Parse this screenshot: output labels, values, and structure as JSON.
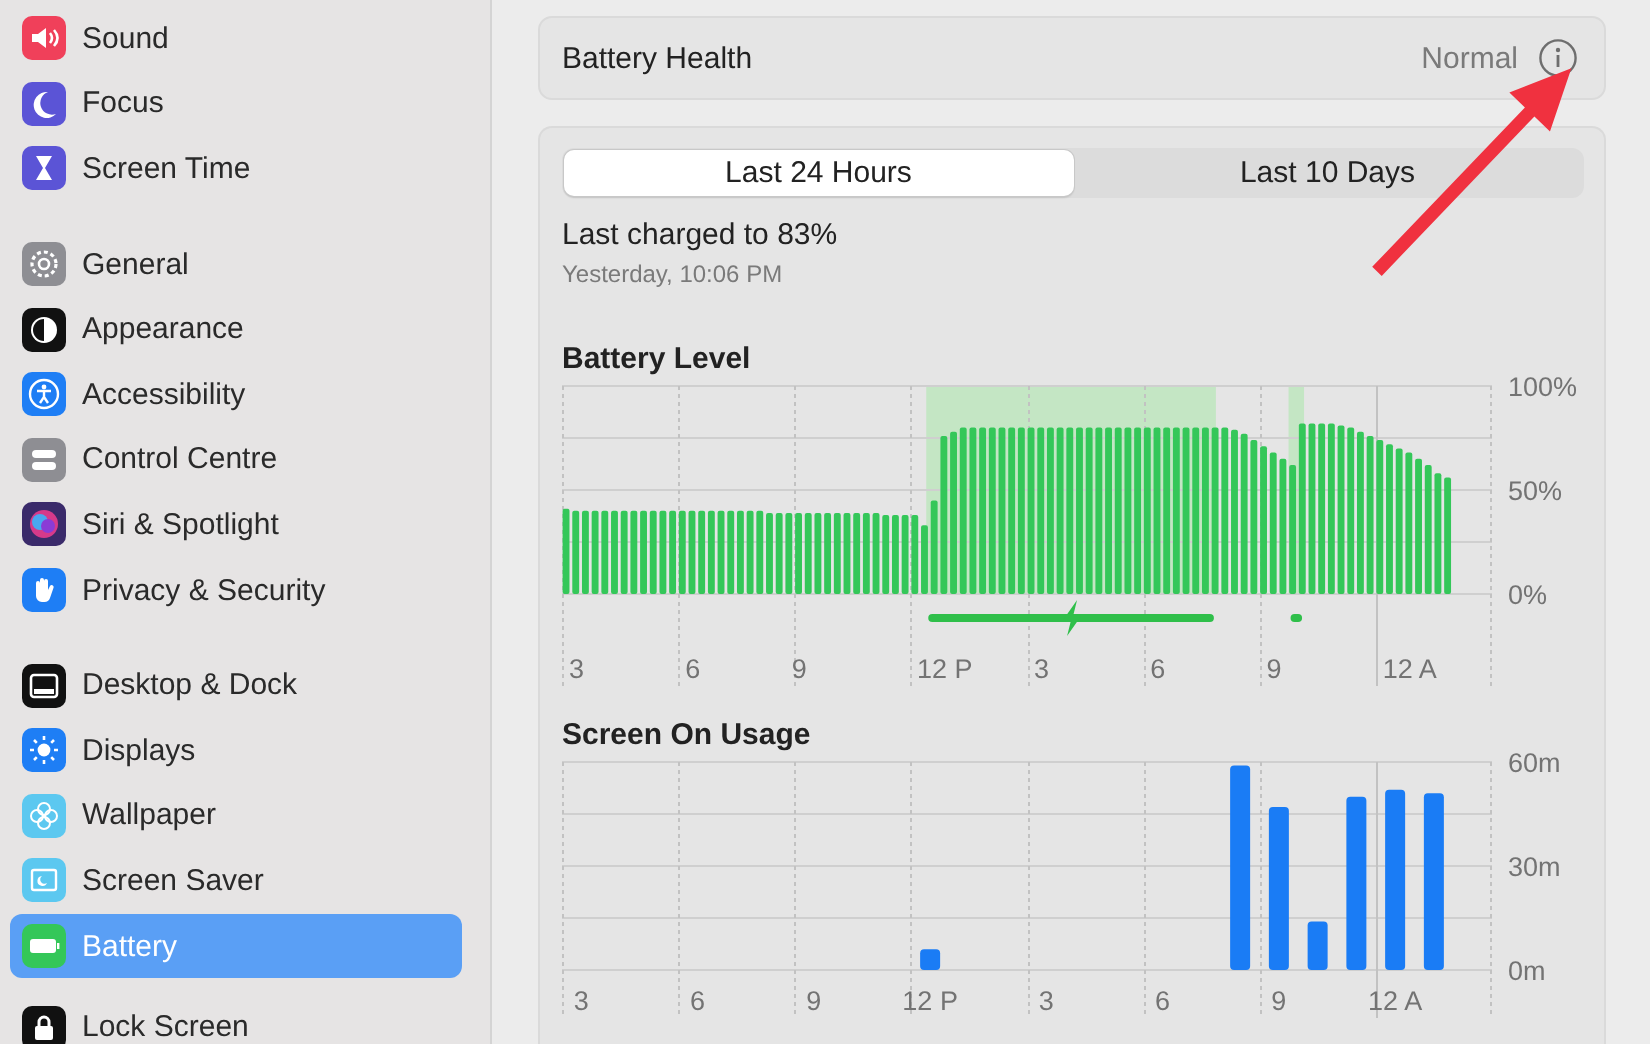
{
  "sidebar": {
    "groups": [
      {
        "items": [
          {
            "label": "Sound",
            "kind": "sound",
            "selected": false
          },
          {
            "label": "Focus",
            "kind": "focus",
            "selected": false
          },
          {
            "label": "Screen Time",
            "kind": "screentime",
            "selected": false
          }
        ]
      },
      {
        "items": [
          {
            "label": "General",
            "kind": "general",
            "selected": false
          },
          {
            "label": "Appearance",
            "kind": "appearance",
            "selected": false
          },
          {
            "label": "Accessibility",
            "kind": "accessibility",
            "selected": false
          },
          {
            "label": "Control Centre",
            "kind": "controlcentre",
            "selected": false
          },
          {
            "label": "Siri & Spotlight",
            "kind": "siri",
            "selected": false
          },
          {
            "label": "Privacy & Security",
            "kind": "privacy",
            "selected": false
          }
        ]
      },
      {
        "items": [
          {
            "label": "Desktop & Dock",
            "kind": "desktop",
            "selected": false
          },
          {
            "label": "Displays",
            "kind": "displays",
            "selected": false
          },
          {
            "label": "Wallpaper",
            "kind": "wallpaper",
            "selected": false
          },
          {
            "label": "Screen Saver",
            "kind": "screensaver",
            "selected": false
          },
          {
            "label": "Battery",
            "kind": "battery",
            "selected": true
          }
        ]
      },
      {
        "items": [
          {
            "label": "Lock Screen",
            "kind": "lock",
            "selected": false
          }
        ]
      }
    ]
  },
  "battery_health": {
    "label": "Battery Health",
    "value": "Normal"
  },
  "usage": {
    "tabs": [
      {
        "label": "Last 24 Hours",
        "selected": true
      },
      {
        "label": "Last 10 Days",
        "selected": false
      }
    ],
    "last_charged": "Last charged to 83%",
    "last_charged_time": "Yesterday, 10:06 PM",
    "battery_level": {
      "chart_data": {
        "type": "bar",
        "title": "Battery Level",
        "categories": [
          null,
          "3",
          null,
          null,
          null,
          null,
          null,
          null,
          null,
          null,
          null,
          null,
          null,
          "6",
          null,
          null,
          null,
          null,
          null,
          null,
          null,
          null,
          null,
          null,
          "9",
          null,
          null,
          null,
          null,
          null,
          null,
          null,
          null,
          null,
          null,
          null,
          null,
          null,
          null,
          "12 P",
          null,
          null,
          null,
          null,
          null,
          null,
          null,
          null,
          null,
          "3",
          null,
          null,
          null,
          null,
          null,
          null,
          null,
          null,
          null,
          null,
          null,
          "6",
          null,
          null,
          null,
          null,
          null,
          null,
          null,
          null,
          null,
          null,
          null,
          "9",
          null,
          null,
          null,
          null,
          null,
          null,
          null,
          null,
          null,
          null,
          null,
          null,
          null,
          "12 A",
          null,
          null,
          null,
          null,
          null,
          null,
          null,
          null
        ],
        "series": [
          {
            "color": "#34c759",
            "values": [
              41,
              40,
              40,
              40,
              40,
              40,
              40,
              40,
              40,
              40,
              40,
              40,
              40,
              40,
              40,
              40,
              40,
              40,
              40,
              40,
              40,
              39,
              39,
              39,
              39,
              39,
              39,
              39,
              39,
              39,
              39,
              39,
              39,
              38,
              38,
              38,
              38,
              33,
              45,
              76,
              78,
              80,
              80,
              80,
              80,
              80,
              80,
              80,
              80,
              80,
              80,
              80,
              80,
              80,
              80,
              80,
              80,
              80,
              80,
              80,
              80,
              80,
              80,
              80,
              80,
              80,
              80,
              80,
              80,
              79,
              77,
              74,
              71,
              68,
              65,
              62,
              82,
              82,
              82,
              82,
              81,
              80,
              78,
              76,
              74,
              72,
              70,
              68,
              65,
              62,
              58,
              56,
              null,
              null,
              null,
              null
            ]
          }
        ],
        "ylim": [
          0,
          100
        ],
        "yticks": [
          {
            "value": 0,
            "label": "0%"
          },
          {
            "value": 50,
            "label": "50%"
          },
          {
            "value": 100,
            "label": "100%"
          }
        ]
      }
    },
    "screen_on_usage": {
      "chart_data": {
        "type": "bar",
        "title": "Screen On Usage",
        "categories": [
          "3",
          null,
          null,
          "6",
          null,
          null,
          "9",
          null,
          null,
          "12 P",
          null,
          null,
          "3",
          null,
          null,
          "6",
          null,
          null,
          "9",
          null,
          null,
          "12 A",
          null,
          null
        ],
        "series": [
          {
            "color": "#1a7cf5",
            "values": [
              null,
              null,
              null,
              null,
              null,
              null,
              null,
              null,
              null,
              6,
              null,
              null,
              null,
              null,
              null,
              null,
              null,
              59,
              47,
              14,
              50,
              52,
              51,
              null
            ]
          }
        ],
        "ylim": [
          0,
          60
        ],
        "yticks": [
          {
            "value": 0,
            "label": "0m"
          },
          {
            "value": 30,
            "label": "30m"
          },
          {
            "value": 60,
            "label": "60m"
          }
        ]
      }
    }
  }
}
